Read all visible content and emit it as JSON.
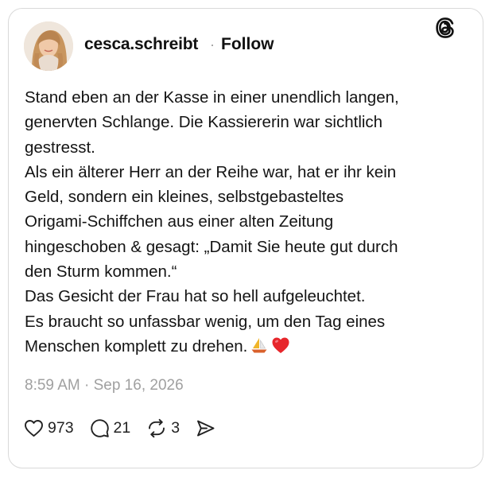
{
  "post": {
    "username": "cesca.schreibt",
    "separator": "·",
    "follow_label": "Follow",
    "avatar": "profile-photo",
    "logo": "threads-logo-icon",
    "text_lines": [
      "Stand eben an der Kasse in einer unendlich langen,",
      "genervten Schlange. Die Kassiererin war sichtlich",
      "gestresst.",
      "Als ein älterer Herr an der Reihe war, hat er ihr kein",
      "Geld, sondern ein kleines, selbstgebasteltes",
      "Origami-Schiffchen aus einer alten Zeitung",
      "hingeschoben & gesagt: „Damit Sie heute gut durch",
      "den Sturm kommen.“",
      "Das Gesicht der Frau hat so hell aufgeleuchtet.",
      "Es braucht so unfassbar wenig, um den Tag eines",
      "Menschen komplett zu drehen."
    ],
    "emojis": [
      "sailboat-emoji",
      "red-heart-emoji"
    ],
    "timestamp": "8:59 AM · Sep 16, 2026",
    "likes": "973",
    "replies": "21",
    "reposts": "3",
    "icons": {
      "like": "heart-icon",
      "reply": "comment-icon",
      "repost": "repost-icon",
      "share": "share-icon"
    },
    "colors": {
      "text": "#141414",
      "muted": "#a0a0a0",
      "border": "#d9d9d9",
      "heart": "#e0245e"
    }
  }
}
